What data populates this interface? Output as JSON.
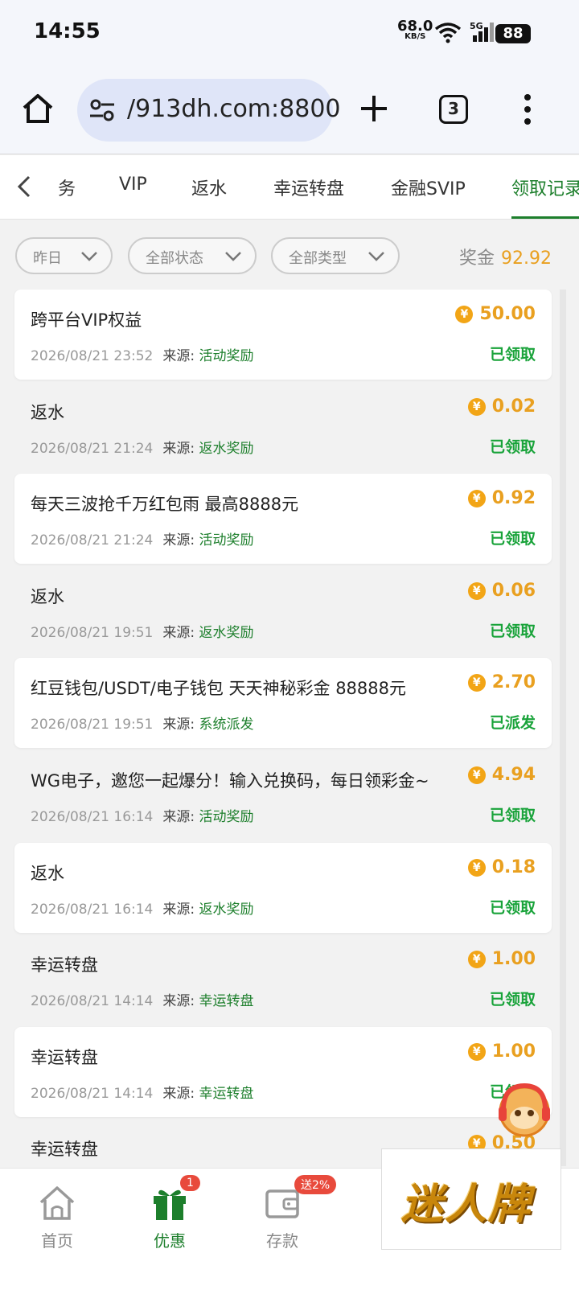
{
  "status_bar": {
    "time": "14:55",
    "net_speed": "68.0",
    "net_unit": "KB/S",
    "network": "5G",
    "battery": "88"
  },
  "browser": {
    "url": "/913dh.com:8800",
    "tab_count": "3"
  },
  "category_tabs": [
    {
      "label": "务",
      "active": false
    },
    {
      "label": "VIP",
      "active": false
    },
    {
      "label": "返水",
      "active": false
    },
    {
      "label": "幸运转盘",
      "active": false
    },
    {
      "label": "金融SVIP",
      "active": false
    },
    {
      "label": "领取记录",
      "active": true
    }
  ],
  "filters": [
    {
      "label": "昨日"
    },
    {
      "label": "全部状态"
    },
    {
      "label": "全部类型"
    }
  ],
  "bonus": {
    "label": "奖金",
    "value": "92.92"
  },
  "source_label": "来源:",
  "coin_symbol": "¥",
  "records": [
    {
      "title": "跨平台VIP权益",
      "time": "2026/08/21 23:52",
      "source": "活动奖励",
      "amount": "50.00",
      "status": "已领取"
    },
    {
      "title": "返水",
      "time": "2026/08/21 21:24",
      "source": "返水奖励",
      "amount": "0.02",
      "status": "已领取"
    },
    {
      "title": "每天三波抢千万红包雨 最高8888元",
      "time": "2026/08/21 21:24",
      "source": "活动奖励",
      "amount": "0.92",
      "status": "已领取"
    },
    {
      "title": "返水",
      "time": "2026/08/21 19:51",
      "source": "返水奖励",
      "amount": "0.06",
      "status": "已领取"
    },
    {
      "title": "红豆钱包/USDT/电子钱包 天天神秘彩金 88888元",
      "time": "2026/08/21 19:51",
      "source": "系统派发",
      "amount": "2.70",
      "status": "已派发"
    },
    {
      "title": "WG电子，邀您一起爆分！输入兑换码，每日领彩金~",
      "time": "2026/08/21 16:14",
      "source": "活动奖励",
      "amount": "4.94",
      "status": "已领取"
    },
    {
      "title": "返水",
      "time": "2026/08/21 16:14",
      "source": "返水奖励",
      "amount": "0.18",
      "status": "已领取"
    },
    {
      "title": "幸运转盘",
      "time": "2026/08/21 14:14",
      "source": "幸运转盘",
      "amount": "1.00",
      "status": "已领取"
    },
    {
      "title": "幸运转盘",
      "time": "2026/08/21 14:14",
      "source": "幸运转盘",
      "amount": "1.00",
      "status": "已领取"
    },
    {
      "title": "幸运转盘",
      "time": "",
      "source": "",
      "amount": "0.50",
      "status": ""
    }
  ],
  "bottom_nav": [
    {
      "label": "首页",
      "icon": "home-icon",
      "active": false
    },
    {
      "label": "优惠",
      "icon": "gift-icon",
      "active": true,
      "badge": "1"
    },
    {
      "label": "存款",
      "icon": "wallet-icon",
      "active": false,
      "badge": "送2%"
    }
  ],
  "promo": {
    "text": "迷人牌"
  },
  "colors": {
    "accent_green": "#1d7f2c",
    "status_green": "#19a33a",
    "gold": "#e9a020",
    "badge_red": "#e84a3c"
  }
}
